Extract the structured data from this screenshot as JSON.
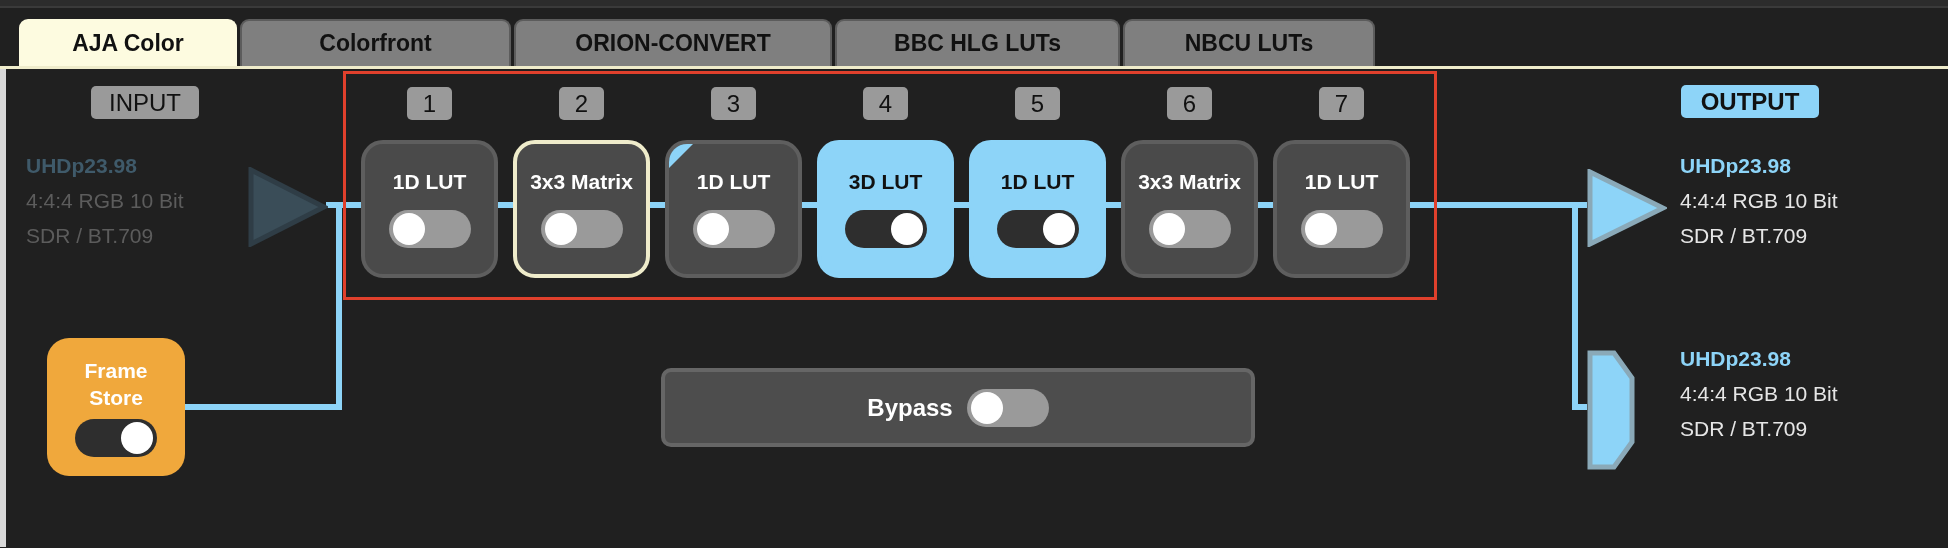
{
  "tabs": [
    {
      "label": "AJA Color",
      "selected": true
    },
    {
      "label": "Colorfront",
      "selected": false
    },
    {
      "label": "ORION-CONVERT",
      "selected": false
    },
    {
      "label": "BBC HLG LUTs",
      "selected": false
    },
    {
      "label": "NBCU LUTs",
      "selected": false
    }
  ],
  "input": {
    "label": "INPUT",
    "active": false,
    "format": "UHDp23.98",
    "sampling": "4:4:4 RGB 10 Bit",
    "color_space": "SDR / BT.709"
  },
  "pipeline": {
    "highlighted": true,
    "slots": [
      {
        "number": "1",
        "label": "1D LUT",
        "on": false,
        "selected": false,
        "flagged": false
      },
      {
        "number": "2",
        "label": "3x3 Matrix",
        "on": false,
        "selected": true,
        "flagged": false
      },
      {
        "number": "3",
        "label": "1D LUT",
        "on": false,
        "selected": false,
        "flagged": true
      },
      {
        "number": "4",
        "label": "3D LUT",
        "on": true,
        "selected": false,
        "flagged": false
      },
      {
        "number": "5",
        "label": "1D LUT",
        "on": true,
        "selected": false,
        "flagged": false
      },
      {
        "number": "6",
        "label": "3x3 Matrix",
        "on": false,
        "selected": false,
        "flagged": false
      },
      {
        "number": "7",
        "label": "1D LUT",
        "on": false,
        "selected": false,
        "flagged": false
      }
    ]
  },
  "frame_store": {
    "label": "Frame Store",
    "on": true
  },
  "bypass": {
    "label": "Bypass",
    "on": false
  },
  "output": {
    "label": "OUTPUT",
    "destinations": [
      {
        "kind": "sdi",
        "active": true,
        "format": "UHDp23.98",
        "sampling": "4:4:4 RGB 10 Bit",
        "color_space": "SDR / BT.709"
      },
      {
        "kind": "hdmi",
        "active": true,
        "format": "UHDp23.98",
        "sampling": "4:4:4 RGB 10 Bit",
        "color_space": "SDR / BT.709"
      }
    ]
  }
}
